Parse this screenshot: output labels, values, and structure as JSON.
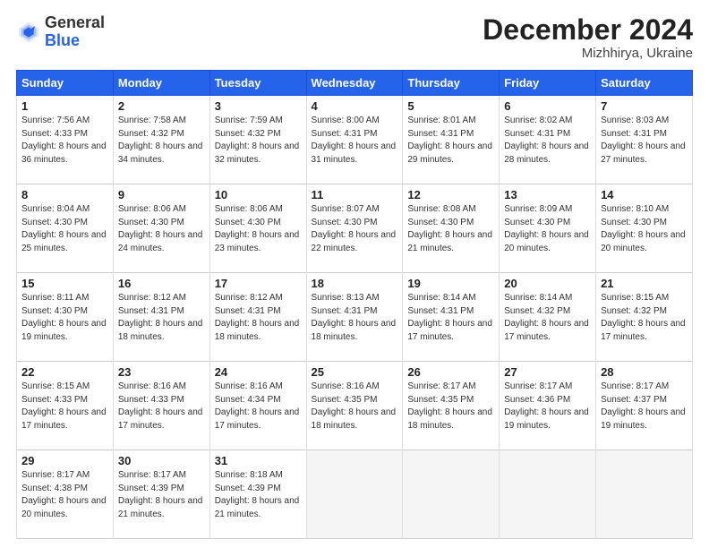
{
  "header": {
    "logo_general": "General",
    "logo_blue": "Blue",
    "month_title": "December 2024",
    "location": "Mizhhirya, Ukraine"
  },
  "days_of_week": [
    "Sunday",
    "Monday",
    "Tuesday",
    "Wednesday",
    "Thursday",
    "Friday",
    "Saturday"
  ],
  "weeks": [
    [
      {
        "day": "1",
        "sunrise": "Sunrise: 7:56 AM",
        "sunset": "Sunset: 4:33 PM",
        "daylight": "Daylight: 8 hours and 36 minutes."
      },
      {
        "day": "2",
        "sunrise": "Sunrise: 7:58 AM",
        "sunset": "Sunset: 4:32 PM",
        "daylight": "Daylight: 8 hours and 34 minutes."
      },
      {
        "day": "3",
        "sunrise": "Sunrise: 7:59 AM",
        "sunset": "Sunset: 4:32 PM",
        "daylight": "Daylight: 8 hours and 32 minutes."
      },
      {
        "day": "4",
        "sunrise": "Sunrise: 8:00 AM",
        "sunset": "Sunset: 4:31 PM",
        "daylight": "Daylight: 8 hours and 31 minutes."
      },
      {
        "day": "5",
        "sunrise": "Sunrise: 8:01 AM",
        "sunset": "Sunset: 4:31 PM",
        "daylight": "Daylight: 8 hours and 29 minutes."
      },
      {
        "day": "6",
        "sunrise": "Sunrise: 8:02 AM",
        "sunset": "Sunset: 4:31 PM",
        "daylight": "Daylight: 8 hours and 28 minutes."
      },
      {
        "day": "7",
        "sunrise": "Sunrise: 8:03 AM",
        "sunset": "Sunset: 4:31 PM",
        "daylight": "Daylight: 8 hours and 27 minutes."
      }
    ],
    [
      {
        "day": "8",
        "sunrise": "Sunrise: 8:04 AM",
        "sunset": "Sunset: 4:30 PM",
        "daylight": "Daylight: 8 hours and 25 minutes."
      },
      {
        "day": "9",
        "sunrise": "Sunrise: 8:06 AM",
        "sunset": "Sunset: 4:30 PM",
        "daylight": "Daylight: 8 hours and 24 minutes."
      },
      {
        "day": "10",
        "sunrise": "Sunrise: 8:06 AM",
        "sunset": "Sunset: 4:30 PM",
        "daylight": "Daylight: 8 hours and 23 minutes."
      },
      {
        "day": "11",
        "sunrise": "Sunrise: 8:07 AM",
        "sunset": "Sunset: 4:30 PM",
        "daylight": "Daylight: 8 hours and 22 minutes."
      },
      {
        "day": "12",
        "sunrise": "Sunrise: 8:08 AM",
        "sunset": "Sunset: 4:30 PM",
        "daylight": "Daylight: 8 hours and 21 minutes."
      },
      {
        "day": "13",
        "sunrise": "Sunrise: 8:09 AM",
        "sunset": "Sunset: 4:30 PM",
        "daylight": "Daylight: 8 hours and 20 minutes."
      },
      {
        "day": "14",
        "sunrise": "Sunrise: 8:10 AM",
        "sunset": "Sunset: 4:30 PM",
        "daylight": "Daylight: 8 hours and 20 minutes."
      }
    ],
    [
      {
        "day": "15",
        "sunrise": "Sunrise: 8:11 AM",
        "sunset": "Sunset: 4:30 PM",
        "daylight": "Daylight: 8 hours and 19 minutes."
      },
      {
        "day": "16",
        "sunrise": "Sunrise: 8:12 AM",
        "sunset": "Sunset: 4:31 PM",
        "daylight": "Daylight: 8 hours and 18 minutes."
      },
      {
        "day": "17",
        "sunrise": "Sunrise: 8:12 AM",
        "sunset": "Sunset: 4:31 PM",
        "daylight": "Daylight: 8 hours and 18 minutes."
      },
      {
        "day": "18",
        "sunrise": "Sunrise: 8:13 AM",
        "sunset": "Sunset: 4:31 PM",
        "daylight": "Daylight: 8 hours and 18 minutes."
      },
      {
        "day": "19",
        "sunrise": "Sunrise: 8:14 AM",
        "sunset": "Sunset: 4:31 PM",
        "daylight": "Daylight: 8 hours and 17 minutes."
      },
      {
        "day": "20",
        "sunrise": "Sunrise: 8:14 AM",
        "sunset": "Sunset: 4:32 PM",
        "daylight": "Daylight: 8 hours and 17 minutes."
      },
      {
        "day": "21",
        "sunrise": "Sunrise: 8:15 AM",
        "sunset": "Sunset: 4:32 PM",
        "daylight": "Daylight: 8 hours and 17 minutes."
      }
    ],
    [
      {
        "day": "22",
        "sunrise": "Sunrise: 8:15 AM",
        "sunset": "Sunset: 4:33 PM",
        "daylight": "Daylight: 8 hours and 17 minutes."
      },
      {
        "day": "23",
        "sunrise": "Sunrise: 8:16 AM",
        "sunset": "Sunset: 4:33 PM",
        "daylight": "Daylight: 8 hours and 17 minutes."
      },
      {
        "day": "24",
        "sunrise": "Sunrise: 8:16 AM",
        "sunset": "Sunset: 4:34 PM",
        "daylight": "Daylight: 8 hours and 17 minutes."
      },
      {
        "day": "25",
        "sunrise": "Sunrise: 8:16 AM",
        "sunset": "Sunset: 4:35 PM",
        "daylight": "Daylight: 8 hours and 18 minutes."
      },
      {
        "day": "26",
        "sunrise": "Sunrise: 8:17 AM",
        "sunset": "Sunset: 4:35 PM",
        "daylight": "Daylight: 8 hours and 18 minutes."
      },
      {
        "day": "27",
        "sunrise": "Sunrise: 8:17 AM",
        "sunset": "Sunset: 4:36 PM",
        "daylight": "Daylight: 8 hours and 19 minutes."
      },
      {
        "day": "28",
        "sunrise": "Sunrise: 8:17 AM",
        "sunset": "Sunset: 4:37 PM",
        "daylight": "Daylight: 8 hours and 19 minutes."
      }
    ],
    [
      {
        "day": "29",
        "sunrise": "Sunrise: 8:17 AM",
        "sunset": "Sunset: 4:38 PM",
        "daylight": "Daylight: 8 hours and 20 minutes."
      },
      {
        "day": "30",
        "sunrise": "Sunrise: 8:17 AM",
        "sunset": "Sunset: 4:39 PM",
        "daylight": "Daylight: 8 hours and 21 minutes."
      },
      {
        "day": "31",
        "sunrise": "Sunrise: 8:18 AM",
        "sunset": "Sunset: 4:39 PM",
        "daylight": "Daylight: 8 hours and 21 minutes."
      },
      null,
      null,
      null,
      null
    ]
  ]
}
